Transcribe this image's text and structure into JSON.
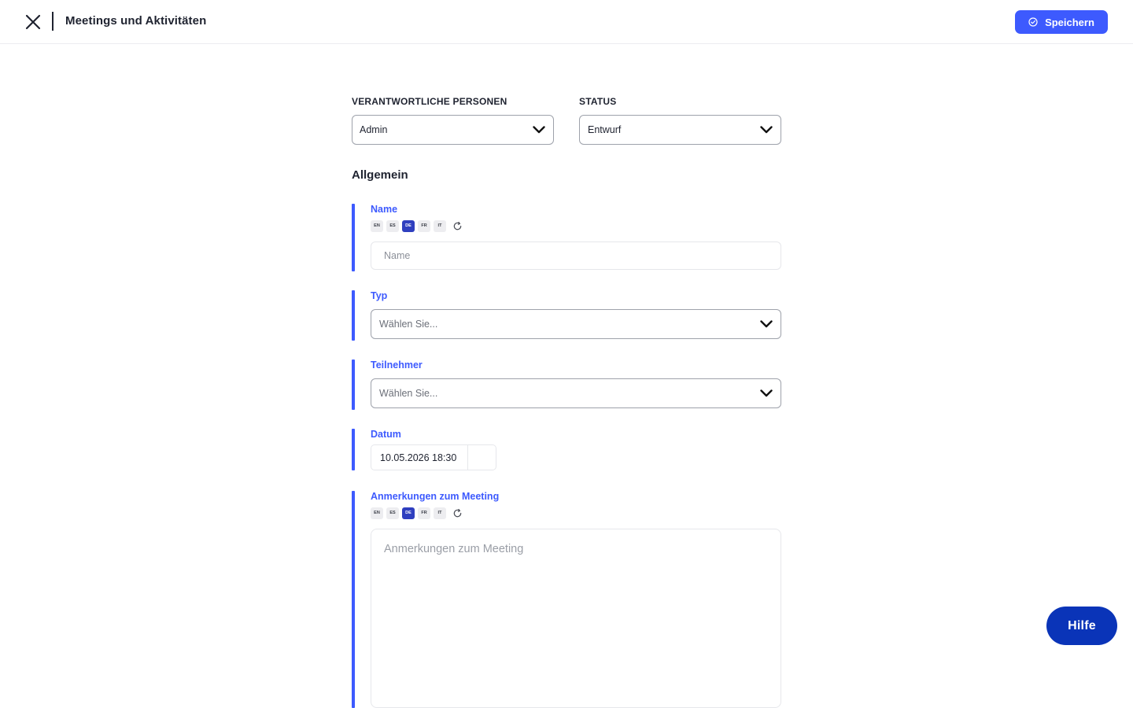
{
  "header": {
    "title": "Meetings und Aktivitäten",
    "save_label": "Speichern",
    "close_icon": "close-icon",
    "save_icon": "check-circle-icon"
  },
  "top_fields": {
    "responsible": {
      "label": "VERANTWORTLICHE PERSONEN",
      "value": "Admin"
    },
    "status": {
      "label": "STATUS",
      "value": "Entwurf"
    }
  },
  "section": {
    "title": "Allgemein"
  },
  "languages": [
    "EN",
    "ES",
    "DE",
    "FR",
    "IT"
  ],
  "active_language": "DE",
  "fields": {
    "name": {
      "label": "Name",
      "placeholder": "Name",
      "value": ""
    },
    "typ": {
      "label": "Typ",
      "value": "Wählen Sie..."
    },
    "teilnehmer": {
      "label": "Teilnehmer",
      "value": "Wählen Sie..."
    },
    "datum": {
      "label": "Datum",
      "value": "10.05.2026 18:30"
    },
    "notes": {
      "label": "Anmerkungen zum Meeting",
      "placeholder": "Anmerkungen zum Meeting",
      "value": ""
    }
  },
  "help": {
    "label": "Hilfe"
  },
  "colors": {
    "accent": "#3d5afe",
    "help_button": "#0a34b8",
    "active_language": "#2f3fbf"
  }
}
